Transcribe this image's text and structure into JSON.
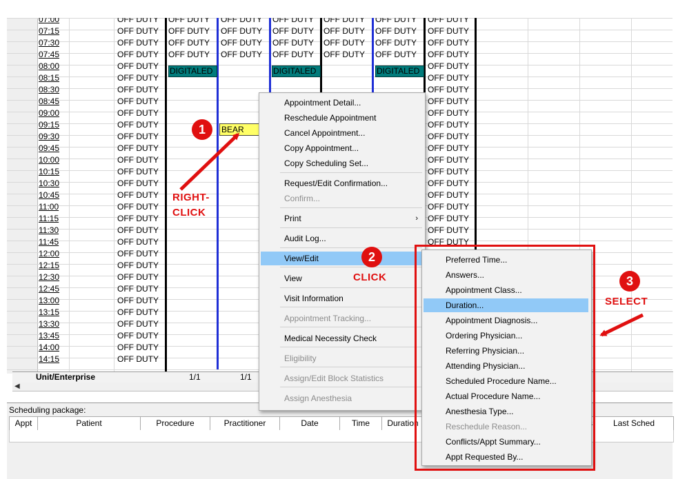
{
  "times": [
    "07:00",
    "07:15",
    "07:30",
    "07:45",
    "08:00",
    "08:15",
    "08:30",
    "08:45",
    "09:00",
    "09:15",
    "09:30",
    "09:45",
    "10:00",
    "10:15",
    "10:30",
    "10:45",
    "11:00",
    "11:15",
    "11:30",
    "11:45",
    "12:00",
    "12:15",
    "12:30",
    "12:45",
    "13:00",
    "13:15",
    "13:30",
    "13:45",
    "14:00",
    "14:15"
  ],
  "grid": {
    "off_duty": "OFF DUTY",
    "digitaled": "DIGITALED",
    "appointment": "BEAR",
    "unit_label": "Unit/Enterprise",
    "counts": [
      "1/1",
      "1/1"
    ]
  },
  "package": {
    "label": "Scheduling package:",
    "columns": [
      "Appt",
      "Patient",
      "Procedure",
      "Practitioner",
      "Date",
      "Time",
      "Duration",
      "s",
      "Last Sched"
    ]
  },
  "context_menu": {
    "items": [
      {
        "label": "Appointment Detail...",
        "disabled": false
      },
      {
        "label": "Reschedule Appointment",
        "disabled": false
      },
      {
        "label": "Cancel Appointment...",
        "disabled": false
      },
      {
        "label": "Copy Appointment...",
        "disabled": false
      },
      {
        "label": "Copy Scheduling Set...",
        "disabled": false
      },
      {
        "label": "Request/Edit Confirmation...",
        "disabled": false
      },
      {
        "label": "Confirm...",
        "disabled": true
      },
      {
        "label": "Print",
        "disabled": false,
        "submenu": true
      },
      {
        "label": "Audit Log...",
        "disabled": false
      },
      {
        "label": "View/Edit",
        "disabled": false,
        "highlighted": true
      },
      {
        "label": "View",
        "disabled": false
      },
      {
        "label": "Visit Information",
        "disabled": false
      },
      {
        "label": "Appointment Tracking...",
        "disabled": true
      },
      {
        "label": "Medical Necessity Check",
        "disabled": false
      },
      {
        "label": "Eligibility",
        "disabled": true
      },
      {
        "label": "Assign/Edit Block Statistics",
        "disabled": true
      },
      {
        "label": "Assign Anesthesia",
        "disabled": true
      }
    ]
  },
  "submenu": {
    "items": [
      {
        "label": "Preferred Time...",
        "disabled": false
      },
      {
        "label": "Answers...",
        "disabled": false
      },
      {
        "label": "Appointment Class...",
        "disabled": false
      },
      {
        "label": "Duration...",
        "disabled": false,
        "highlighted": true
      },
      {
        "label": "Appointment Diagnosis...",
        "disabled": false
      },
      {
        "label": "Ordering Physician...",
        "disabled": false
      },
      {
        "label": "Referring Physician...",
        "disabled": false
      },
      {
        "label": "Attending Physician...",
        "disabled": false
      },
      {
        "label": "Scheduled Procedure Name...",
        "disabled": false
      },
      {
        "label": "Actual Procedure Name...",
        "disabled": false
      },
      {
        "label": "Anesthesia Type...",
        "disabled": false
      },
      {
        "label": "Reschedule Reason...",
        "disabled": true
      },
      {
        "label": "Conflicts/Appt Summary...",
        "disabled": false
      },
      {
        "label": "Appt Requested By...",
        "disabled": false
      }
    ]
  },
  "annotations": {
    "step1_number": "1",
    "step1_text": "RIGHT-",
    "step1_text2": "CLICK",
    "step2_number": "2",
    "step2_text": "CLICK",
    "step3_number": "3",
    "step3_text": "SELECT",
    "color": "#e01010"
  },
  "icons": {
    "submenu_arrow": "chevron-right-icon",
    "scroll_left": "arrow-left-icon"
  }
}
